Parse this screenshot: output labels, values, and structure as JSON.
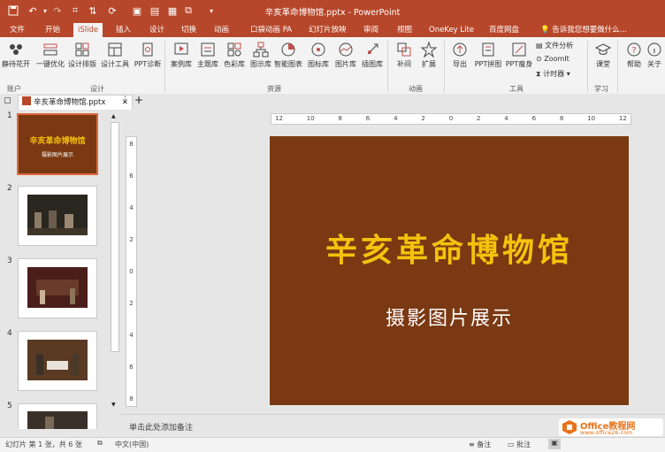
{
  "app": {
    "title": "辛亥革命博物馆.pptx - PowerPoint"
  },
  "colors": {
    "brand": "#b7472a",
    "slide_bg": "#7a3912",
    "slide_title": "#f4c20d",
    "selected_thumb": "#e0683d"
  },
  "tabs": [
    "文件",
    "开始",
    "iSlide",
    "插入",
    "设计",
    "切换",
    "动画",
    "口袋动画 PA",
    "幻灯片放映",
    "审阅",
    "视图",
    "OneKey Lite",
    "百度网盘"
  ],
  "active_tab": "iSlide",
  "tell_me": "告诉我您想要做什么...",
  "ribbon": {
    "buttons": [
      "静待花开",
      "一键优化",
      "设计排版",
      "设计工具",
      "PPT诊断",
      "案例库",
      "主题库",
      "色彩库",
      "图示库",
      "智能图表",
      "图标库",
      "图片库",
      "插图库",
      "补间",
      "扩展",
      "导出",
      "PPT拼图",
      "PPT瘦身",
      "课堂",
      "帮助",
      "关于"
    ],
    "small_items": [
      "文件分析",
      "ZoomIt",
      "计时器"
    ],
    "groups": [
      "账户",
      "设计",
      "资源",
      "动画",
      "工具",
      "学习"
    ]
  },
  "document_tab": "辛亥革命博物馆.pptx",
  "ruler_ticks": [
    "12",
    "10",
    "8",
    "6",
    "4",
    "2",
    "0",
    "2",
    "4",
    "6",
    "8",
    "10",
    "12"
  ],
  "vruler_ticks": [
    "8",
    "6",
    "4",
    "2",
    "0",
    "2",
    "4",
    "6",
    "8"
  ],
  "thumbnails": [
    "1",
    "2",
    "3",
    "4",
    "5"
  ],
  "slide": {
    "title": "辛亥革命博物馆",
    "subtitle": "摄影图片展示"
  },
  "notes_placeholder": "单击此处添加备注",
  "status": {
    "slide_info": "幻灯片 第 1 张，共 6 张",
    "language": "中文(中国)",
    "notes": "备注",
    "comments": "批注"
  },
  "watermark": {
    "brand": "Office教程网",
    "url": "www.office26.com"
  }
}
